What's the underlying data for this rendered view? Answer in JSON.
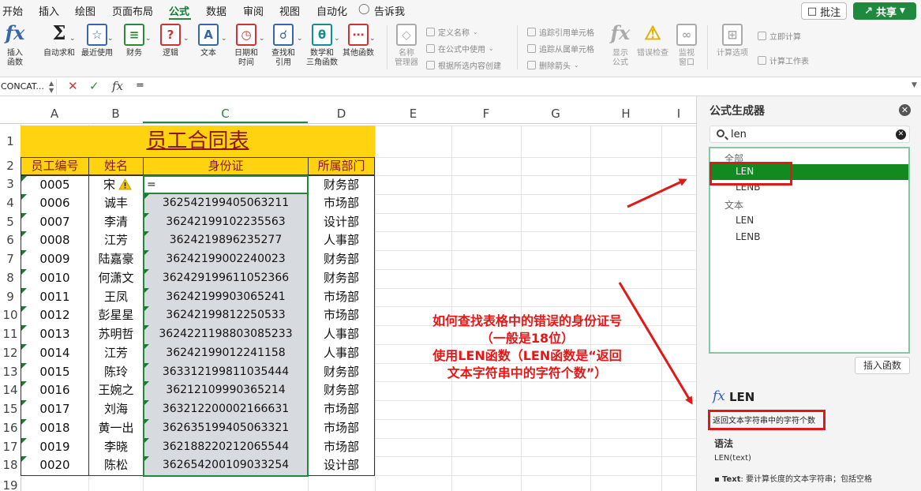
{
  "menu": {
    "tabs": [
      "开始",
      "插入",
      "绘图",
      "页面布局",
      "公式",
      "数据",
      "审阅",
      "视图",
      "自动化"
    ],
    "active": "公式",
    "tell_me": "告诉我",
    "comment": "批注",
    "share": "共享"
  },
  "ribbon": {
    "insert_function": "插入\n函数",
    "autosum": "自动求和",
    "recent": "最近使用",
    "financial": "财务",
    "logical": "逻辑",
    "text": "文本",
    "datetime": "日期和\n时间",
    "lookup": "查找和\n引用",
    "math": "数学和\n三角函数",
    "more": "其他函数",
    "name_manager": "名称\n管理器",
    "define_name": "定义名称",
    "use_in_formula": "在公式中使用",
    "create_from_selection": "根据所选内容创建",
    "trace_precedents": "追踪引用单元格",
    "trace_dependents": "追踪从属单元格",
    "remove_arrows": "删除箭头",
    "show_formulas": "显示\n公式",
    "error_check": "错误检查",
    "watch_window": "监视\n窗口",
    "calc_options": "计算选项",
    "calc_now": "立即计算",
    "calc_sheet": "计算工作表"
  },
  "formula_bar": {
    "name_box": "CONCAT...",
    "fx": "fx",
    "value": "="
  },
  "columns": [
    "A",
    "B",
    "C",
    "D",
    "E",
    "F",
    "G",
    "H",
    "I"
  ],
  "rows": [
    "1",
    "2",
    "3",
    "4",
    "5",
    "6",
    "7",
    "8",
    "9",
    "10",
    "11",
    "12",
    "13",
    "14",
    "15",
    "16",
    "17",
    "18",
    "19"
  ],
  "table": {
    "title": "员工合同表",
    "headers": [
      "员工编号",
      "姓名",
      "身份证",
      "所属部门"
    ],
    "editing_value": "=",
    "records": [
      [
        "0005",
        "宋",
        "",
        "财务部"
      ],
      [
        "0006",
        "诚丰",
        "362542199405063211",
        "市场部"
      ],
      [
        "0007",
        "李清",
        "36242199102235563",
        "设计部"
      ],
      [
        "0008",
        "江芳",
        "3624219896235277",
        "人事部"
      ],
      [
        "0009",
        "陆嘉豪",
        "36242199002240023",
        "财务部"
      ],
      [
        "0010",
        "何潇文",
        "362429199611052366",
        "财务部"
      ],
      [
        "0011",
        "王凤",
        "36242199903065241",
        "市场部"
      ],
      [
        "0012",
        "彭星星",
        "36242199812250533",
        "市场部"
      ],
      [
        "0013",
        "苏明哲",
        "3624221198803085233",
        "人事部"
      ],
      [
        "0014",
        "江芳",
        "36242199012241158",
        "人事部"
      ],
      [
        "0015",
        "陈玲",
        "363312199811035444",
        "财务部"
      ],
      [
        "0016",
        "王婉之",
        "36212109990365214",
        "财务部"
      ],
      [
        "0017",
        "刘海",
        "363212200002166631",
        "市场部"
      ],
      [
        "0018",
        "黄一出",
        "362635199405063321",
        "市场部"
      ],
      [
        "0019",
        "李晓",
        "362188220212065544",
        "市场部"
      ],
      [
        "0020",
        "陈松",
        "362654200109033254",
        "设计部"
      ]
    ]
  },
  "annotation": [
    "如何查找表格中的错误的身份证号",
    "（一般是18位）",
    "使用LEN函数（LEN函数是“返回",
    "文本字符串中的字符个数”）"
  ],
  "panel": {
    "title": "公式生成器",
    "search_value": "len",
    "groups": [
      {
        "name": "全部",
        "items": [
          "LEN",
          "LENB"
        ]
      },
      {
        "name": "文本",
        "items": [
          "LEN",
          "LENB"
        ]
      }
    ],
    "selected": "LEN",
    "insert_button": "插入函数",
    "fx": "fx",
    "function_name": "LEN",
    "description": "返回文本字符串中的字符个数",
    "syntax_label": "语法",
    "syntax": "LEN(text)",
    "param_name": "Text",
    "param_desc": ": 要计算长度的文本字符串；包括空格"
  },
  "colors": {
    "accent": "#1f8a3e",
    "header_fill": "#ffd310",
    "title_text": "#8b1414",
    "annotation": "#e81515",
    "id_fill": "#d7dbe0"
  }
}
